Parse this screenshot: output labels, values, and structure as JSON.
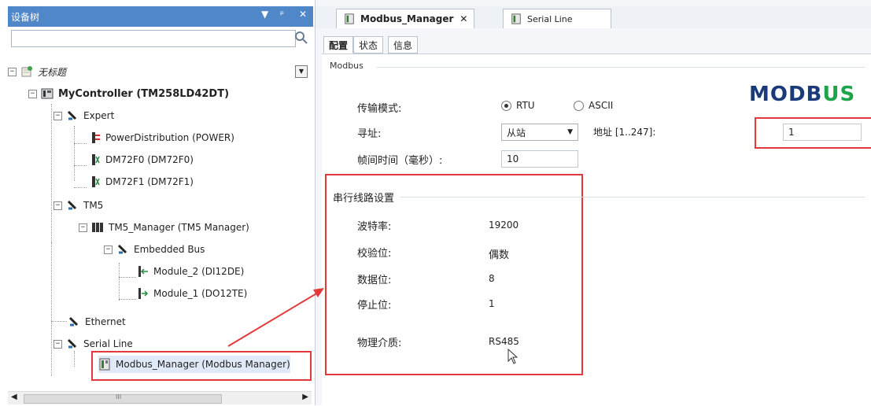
{
  "left_panel": {
    "title": "设备树",
    "controls": {
      "dropdown": "▼",
      "pin": "ᵖ",
      "close": "✕"
    },
    "tree": {
      "root_label": "无标题",
      "controller_label": "MyController (TM258LD42DT)",
      "items": [
        "Expert",
        "PowerDistribution (POWER)",
        "DM72F0 (DM72F0)",
        "DM72F1 (DM72F1)",
        "TM5",
        "TM5_Manager (TM5 Manager)",
        "Embedded Bus",
        "Module_2 (DI12DE)",
        "Module_1 (DO12TE)",
        "Ethernet",
        "Serial Line",
        "Modbus_Manager (Modbus Manager)"
      ]
    },
    "scrollbar_grip": "III"
  },
  "editor": {
    "doc_tabs": [
      "Modbus_Manager",
      "Serial Line"
    ],
    "doc_tab_close": "✕",
    "sub_tabs": [
      "配置",
      "状态",
      "信息"
    ],
    "group_modbus": "Modbus",
    "logo_text": "MODBUS",
    "transmission_mode_label": "传输模式:",
    "mode_rtu": "RTU",
    "mode_ascii": "ASCII",
    "addressing_label": "寻址:",
    "addressing_value": "从站",
    "address_range_label": "地址 [1..247]:",
    "address_value": "1",
    "frame_time_label": "帧间时间（毫秒）:",
    "frame_time_value": "10",
    "serial_settings_title": "串行线路设置",
    "baud_label": "波特率:",
    "baud_value": "19200",
    "parity_label": "校验位:",
    "parity_value": "偶数",
    "data_bits_label": "数据位:",
    "data_bits_value": "8",
    "stop_bits_label": "停止位:",
    "stop_bits_value": "1",
    "physical_medium_label": "物理介质:",
    "physical_medium_value": "RS485"
  },
  "colors": {
    "title_bar": "#4f87c9",
    "highlight": "#e23a3a",
    "logo": "#1b3a7a"
  }
}
